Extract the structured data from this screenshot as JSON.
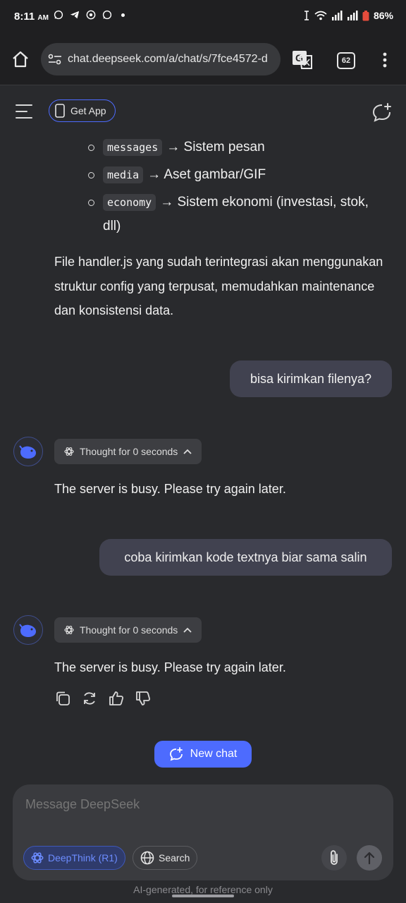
{
  "status_bar": {
    "time": "8:11",
    "ampm": "AM",
    "battery": "86%",
    "icons_left": [
      "whatsapp-icon",
      "telegram-icon",
      "chrome-icon",
      "whatsapp-icon"
    ],
    "icons_right": [
      "alarm-icon",
      "wifi-icon",
      "signal-icon",
      "signal-icon",
      "battery-icon"
    ]
  },
  "browser": {
    "url": "chat.deepseek.com/a/chat/s/7fce4572-d",
    "tab_count": "62"
  },
  "header": {
    "get_app_label": "Get App"
  },
  "messages": {
    "bullets": [
      {
        "code": "messages",
        "text": "→ Sistem pesan"
      },
      {
        "code": "media",
        "text": "→ Aset gambar/GIF"
      },
      {
        "code": "economy",
        "text": "→ Sistem ekonomi (investasi, stok, dll)"
      }
    ],
    "paragraph": "File handler.js yang sudah terintegrasi akan menggunakan struktur config yang terpusat, memudahkan maintenance dan konsistensi data.",
    "user_1": "bisa kirimkan filenya?",
    "thought_1": "Thought for 0 seconds",
    "reply_1": "The server is busy. Please try again later.",
    "user_2": "coba kirimkan kode textnya biar sama salin",
    "thought_2": "Thought for 0 seconds",
    "reply_2": "The server is busy. Please try again later."
  },
  "new_chat_label": "New chat",
  "composer": {
    "placeholder": "Message DeepSeek",
    "deepthink_label": "DeepThink (R1)",
    "search_label": "Search"
  },
  "footer_note": "AI-generated, for reference only",
  "colors": {
    "accent": "#4d6bfe",
    "background": "#292a2d",
    "user_bubble": "#414250"
  }
}
